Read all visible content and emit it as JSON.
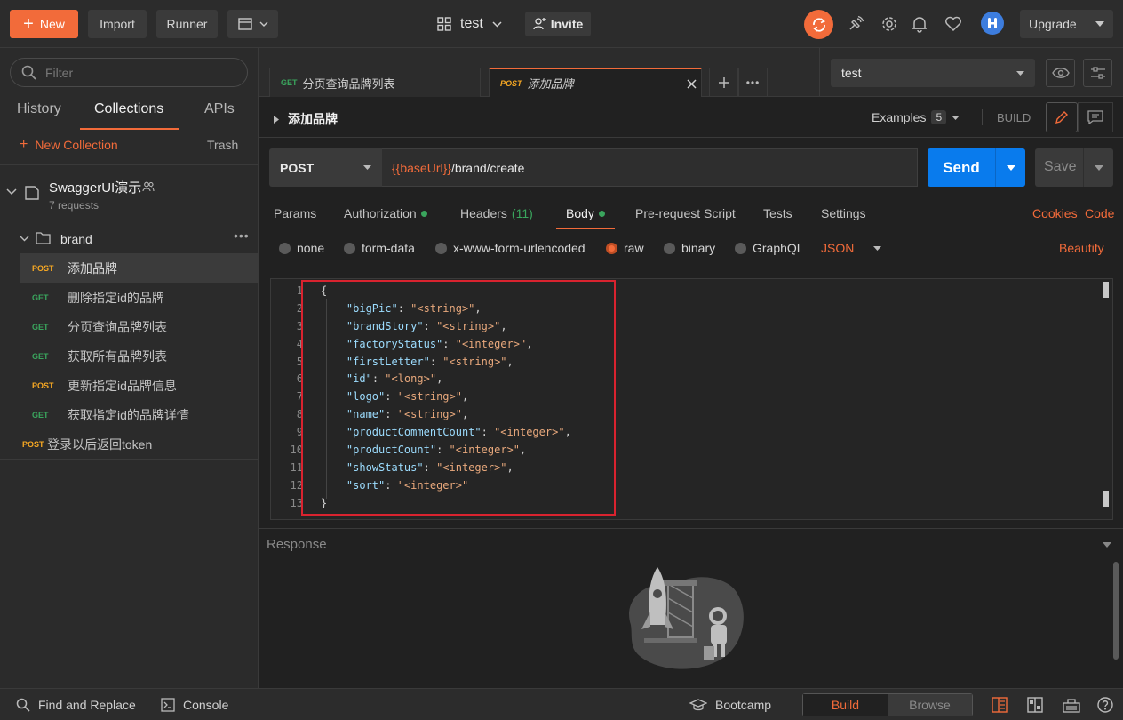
{
  "topbar": {
    "new_label": "New",
    "import_label": "Import",
    "runner_label": "Runner",
    "workspace_name": "test",
    "invite_label": "Invite",
    "upgrade_label": "Upgrade",
    "accent_color": "#f26b3a"
  },
  "sidebar": {
    "filter_placeholder": "Filter",
    "tabs": [
      {
        "label": "History"
      },
      {
        "label": "Collections"
      },
      {
        "label": "APIs"
      }
    ],
    "active_tab": "Collections",
    "new_collection_label": "New Collection",
    "trash_label": "Trash",
    "collection": {
      "name": "SwaggerUI演示",
      "count": "7 requests"
    },
    "folder": {
      "name": "brand",
      "requests": [
        {
          "method": "POST",
          "label": "添加品牌"
        },
        {
          "method": "GET",
          "label": "删除指定id的品牌"
        },
        {
          "method": "GET",
          "label": "分页查询品牌列表"
        },
        {
          "method": "GET",
          "label": "获取所有品牌列表"
        },
        {
          "method": "POST",
          "label": "更新指定id品牌信息"
        },
        {
          "method": "GET",
          "label": "获取指定id的品牌详情"
        }
      ]
    },
    "root_request": {
      "method": "POST",
      "label": "登录以后返回token"
    }
  },
  "request_tabs": [
    {
      "method": "GET",
      "label": "分页查询品牌列表"
    },
    {
      "method": "POST",
      "label": "添加品牌"
    }
  ],
  "environment": {
    "selected": "test"
  },
  "request": {
    "name": "添加品牌",
    "examples_label": "Examples",
    "examples_count": "5",
    "build_label": "BUILD",
    "method": "POST",
    "url_var": "{{baseUrl}}",
    "url_path": "/brand/create",
    "send_label": "Send",
    "save_label": "Save"
  },
  "req_tabs": {
    "params": "Params",
    "authorization": "Authorization",
    "headers": "Headers",
    "headers_count": "(11)",
    "body": "Body",
    "prerequest": "Pre-request Script",
    "tests": "Tests",
    "settings": "Settings",
    "cookies": "Cookies",
    "code": "Code"
  },
  "body_types": {
    "none": "none",
    "form_data": "form-data",
    "urlencoded": "x-www-form-urlencoded",
    "raw": "raw",
    "binary": "binary",
    "graphql": "GraphQL",
    "format": "JSON",
    "beautify": "Beautify",
    "selected": "raw"
  },
  "editor": {
    "line_numbers": [
      "1",
      "2",
      "3",
      "4",
      "5",
      "6",
      "7",
      "8",
      "9",
      "10",
      "11",
      "12",
      "13"
    ],
    "fields": [
      {
        "key": "\"bigPic\"",
        "value": "\"<string>\"",
        "sep": ","
      },
      {
        "key": "\"brandStory\"",
        "value": "\"<string>\"",
        "sep": ","
      },
      {
        "key": "\"factoryStatus\"",
        "value": "\"<integer>\"",
        "sep": ","
      },
      {
        "key": "\"firstLetter\"",
        "value": "\"<string>\"",
        "sep": ","
      },
      {
        "key": "\"id\"",
        "value": "\"<long>\"",
        "sep": ","
      },
      {
        "key": "\"logo\"",
        "value": "\"<string>\"",
        "sep": ","
      },
      {
        "key": "\"name\"",
        "value": "\"<string>\"",
        "sep": ","
      },
      {
        "key": "\"productCommentCount\"",
        "value": "\"<integer>\"",
        "sep": ","
      },
      {
        "key": "\"productCount\"",
        "value": "\"<integer>\"",
        "sep": ","
      },
      {
        "key": "\"showStatus\"",
        "value": "\"<integer>\"",
        "sep": ","
      },
      {
        "key": "\"sort\"",
        "value": "\"<integer>\"",
        "sep": ""
      }
    ],
    "open_brace": "{",
    "close_brace": "}"
  },
  "response": {
    "label": "Response"
  },
  "bottombar": {
    "find_replace": "Find and Replace",
    "console": "Console",
    "bootcamp": "Bootcamp",
    "build": "Build",
    "browse": "Browse"
  }
}
